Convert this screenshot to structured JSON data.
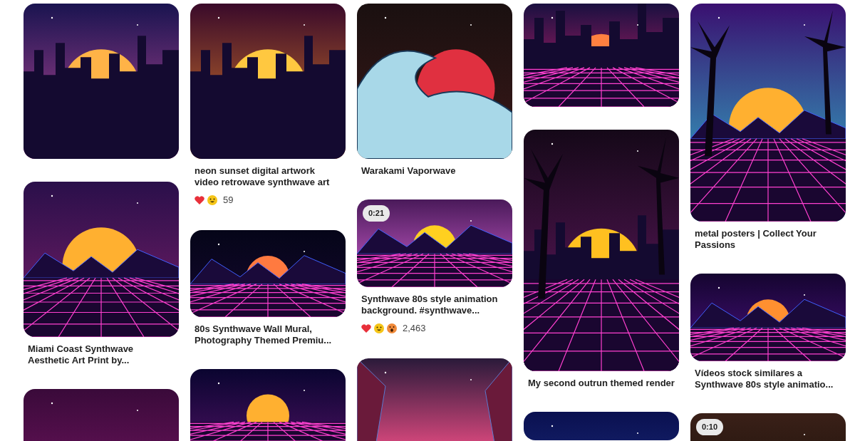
{
  "columns": [
    {
      "pins": [
        {
          "kind": "picture"
        },
        {
          "kind": "picture",
          "title": "Miami Coast Synthwave Aesthetic Art Print by..."
        },
        {
          "kind": "picture"
        }
      ]
    },
    {
      "pins": [
        {
          "kind": "picture",
          "title": "neon sunset digital artwork video retrowave synthwave art",
          "reactions": [
            {
              "kind": "heart"
            },
            {
              "kind": "smile"
            }
          ],
          "reaction_count": "59"
        },
        {
          "kind": "picture",
          "title": "80s Synthwave Wall Mural, Photography Themed Premiu..."
        },
        {
          "kind": "picture"
        }
      ]
    },
    {
      "pins": [
        {
          "kind": "picture",
          "title": "Warakami Vaporwave"
        },
        {
          "kind": "picture",
          "duration": "0:21",
          "title": "Synthwave 80s style animation background. #synthwave...",
          "reactions": [
            {
              "kind": "heart"
            },
            {
              "kind": "smile"
            },
            {
              "kind": "wow"
            }
          ],
          "reaction_count": "2,463"
        },
        {
          "kind": "picture"
        }
      ]
    },
    {
      "pins": [
        {
          "kind": "picture"
        },
        {
          "kind": "picture",
          "title": "My second outrun themed render"
        },
        {
          "kind": "picture"
        }
      ]
    },
    {
      "pins": [
        {
          "kind": "picture",
          "title": "metal posters | Collect Your Passions"
        },
        {
          "kind": "picture",
          "title": "Vídeos stock similares a Synthwave 80s style animatio..."
        },
        {
          "kind": "picture",
          "duration": "0:10"
        }
      ]
    }
  ]
}
